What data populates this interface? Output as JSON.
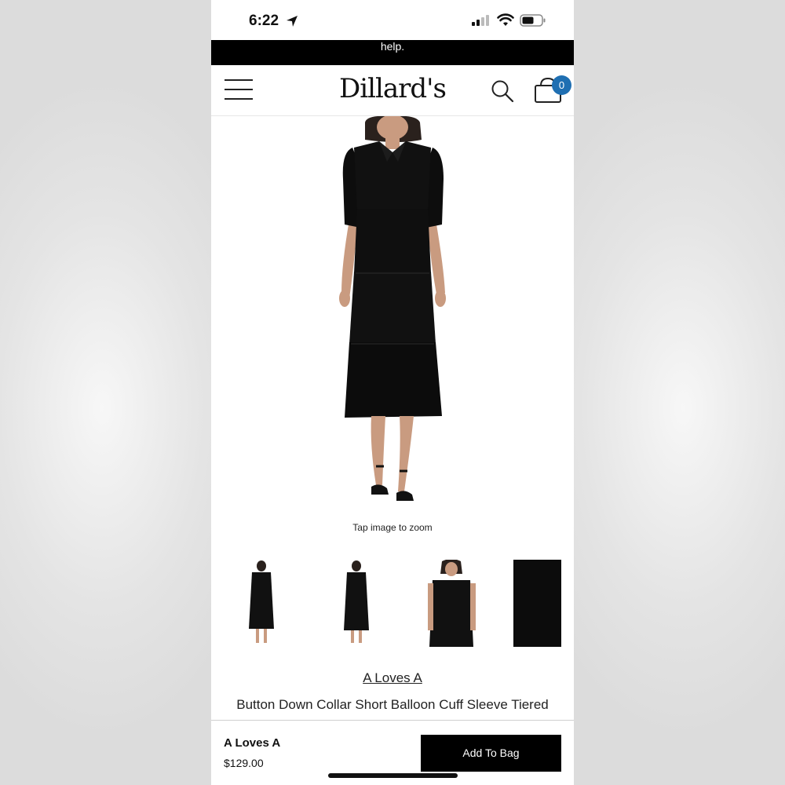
{
  "status_bar": {
    "time": "6:22",
    "icons": [
      "location-arrow-icon",
      "cellular-signal-icon",
      "wifi-icon",
      "battery-icon"
    ]
  },
  "promo_bar": {
    "text": "help."
  },
  "header": {
    "logo": "Dillard's",
    "cart_count": "0",
    "icons": [
      "hamburger-menu-icon",
      "search-icon",
      "shopping-bag-icon"
    ]
  },
  "product": {
    "zoom_hint": "Tap image to zoom",
    "brand": "A Loves A",
    "title": "Button Down Collar Short Balloon Cuff Sleeve Tiered"
  },
  "footer": {
    "brand": "A Loves A",
    "price": "$129.00",
    "add_to_bag": "Add To Bag"
  },
  "colors": {
    "accent_badge": "#1f6fb2",
    "primary_button": "#000000",
    "promo_background": "#000000"
  }
}
